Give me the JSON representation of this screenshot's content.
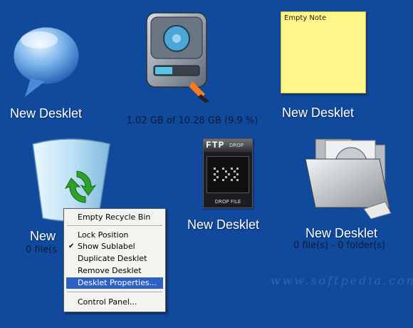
{
  "desklets": {
    "bubble": {
      "label": "New Desklet",
      "icon": "speech-bubble-icon"
    },
    "drive": {
      "label": "",
      "sublabel": "1.02 GB of 10.28 GB (9.9 %)",
      "icon": "hard-drive-icon"
    },
    "note": {
      "label": "New Desklet",
      "note_text": "Empty Note",
      "icon": "sticky-note-icon"
    },
    "recycle": {
      "label": "New",
      "sublabel": "0 file(s",
      "icon": "recycle-bin-icon"
    },
    "ftp": {
      "label": "New Desklet",
      "title": "FTP",
      "title_small": "DROP",
      "footer": "DROP FILE",
      "icon": "ftp-drop-icon"
    },
    "folder": {
      "label": "New Desklet",
      "sublabel": "0 file(s) - 0 folder(s)",
      "icon": "folder-icon"
    }
  },
  "context_menu": {
    "items": [
      {
        "label": "Empty Recycle Bin"
      },
      {
        "label": "Lock Position"
      },
      {
        "label": "Show Sublabel",
        "checked": true
      },
      {
        "label": "Duplicate Desklet"
      },
      {
        "label": "Remove Desklet"
      },
      {
        "label": "Desklet Properties...",
        "selected": true
      },
      {
        "label": "Control Panel..."
      }
    ]
  },
  "watermark": "www.softpedia.com",
  "colors": {
    "desktop": "#114a9c",
    "menu_highlight": "#2d61c4",
    "note_yellow": "#fff68a"
  }
}
